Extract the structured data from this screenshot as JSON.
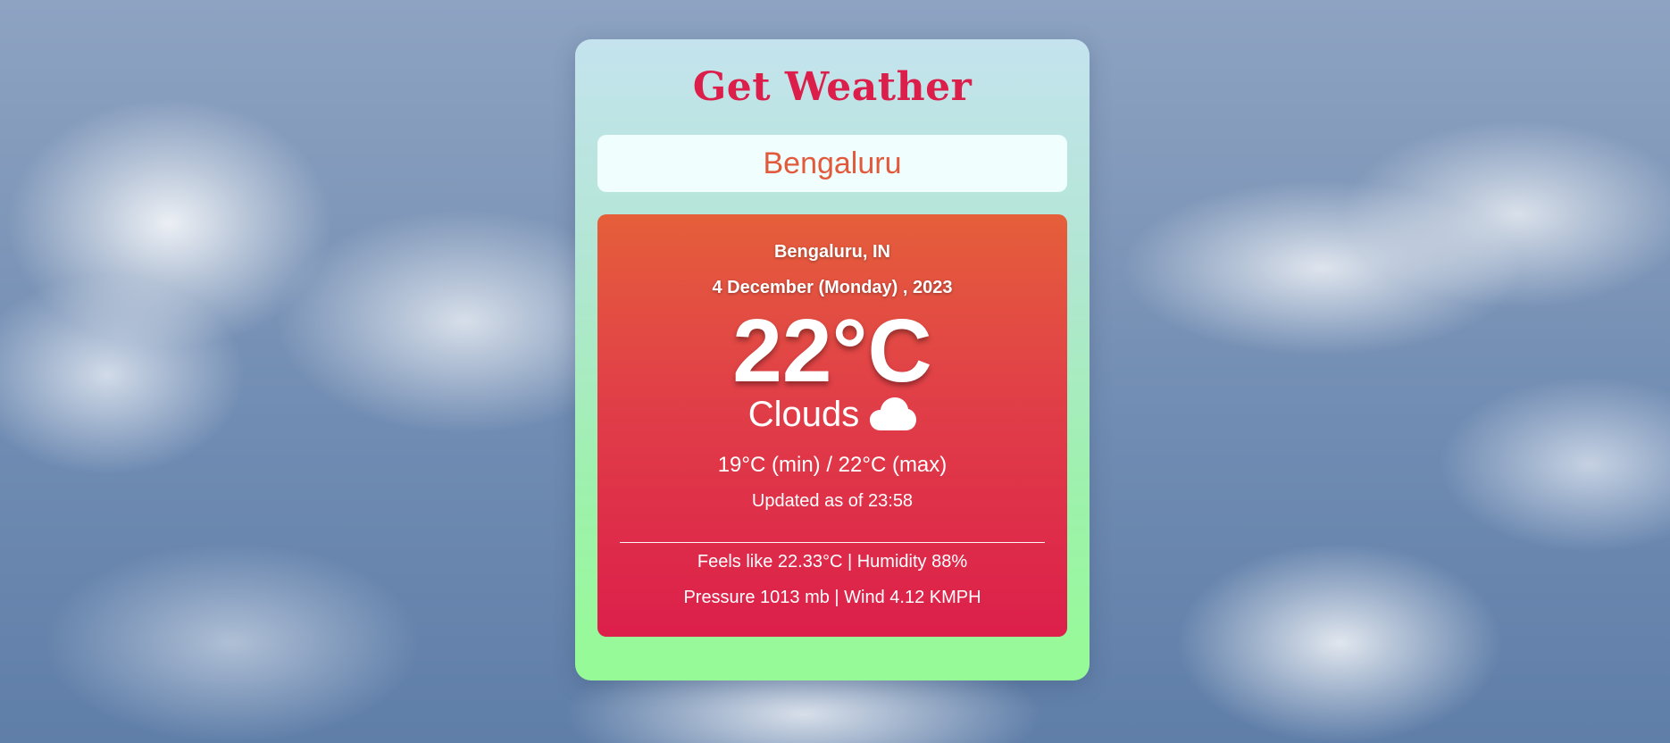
{
  "app": {
    "title": "Get Weather"
  },
  "search": {
    "value": "Bengaluru"
  },
  "weather": {
    "location": "Bengaluru, IN",
    "date": "4 December (Monday) , 2023",
    "temperature": "22°C",
    "condition": "Clouds",
    "condition_icon": "cloud-icon",
    "min_max": "19°C (min) / 22°C (max)",
    "updated": "Updated as of 23:58",
    "feels_humidity": "Feels like 22.33°C | Humidity 88%",
    "pressure_wind": "Pressure 1013 mb | Wind 4.12 KMPH"
  },
  "colors": {
    "title": "#dc1e4b",
    "search_text": "#e25a3b",
    "panel_top": "#e55f3a",
    "panel_bottom": "#dc1f4b",
    "card_top": "#c4e3ee",
    "card_bottom": "#96fb96"
  }
}
